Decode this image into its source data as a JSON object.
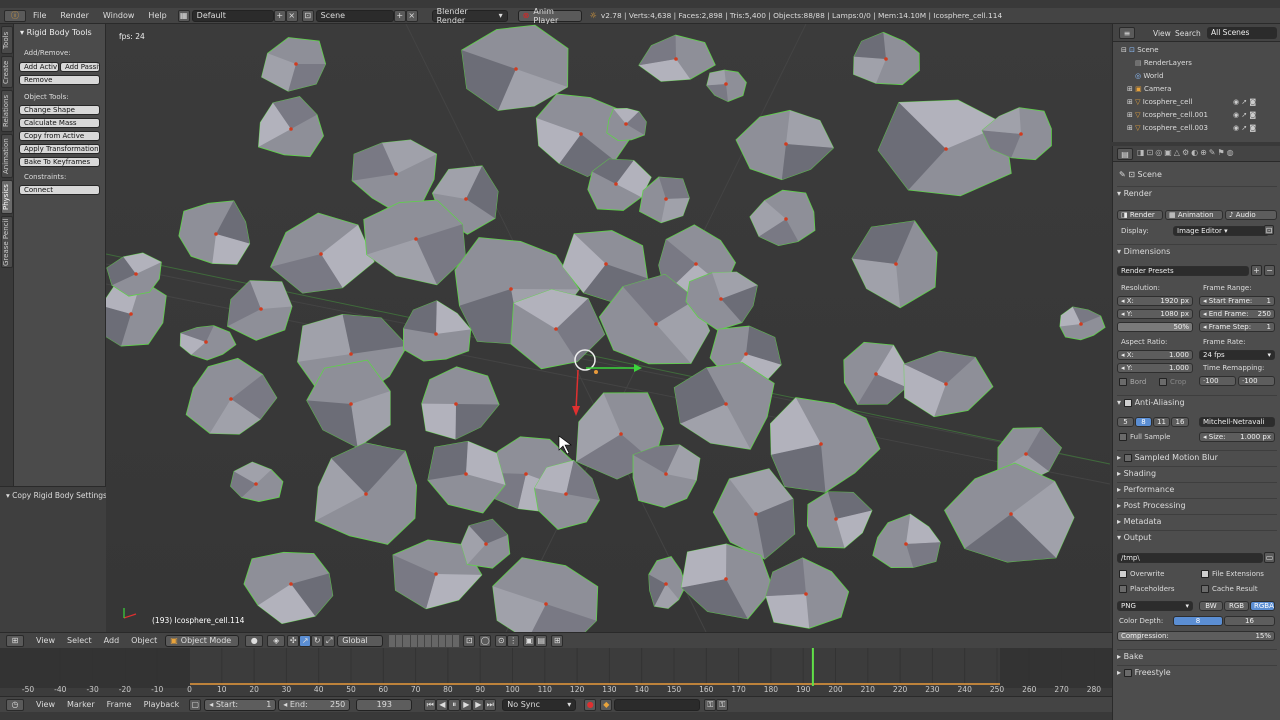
{
  "topbar": {
    "menus": [
      "File",
      "Render",
      "Window",
      "Help"
    ],
    "layout": "Default",
    "scene": "Scene",
    "engine": "Blender Render",
    "anim_player": "Anim Player",
    "stats": "v2.78 | Verts:4,638 | Faces:2,898 | Tris:5,400 | Objects:88/88 | Lamps:0/0 | Mem:14.10M | Icosphere_cell.114"
  },
  "left_tabs": [
    "Tools",
    "Create",
    "Relations",
    "Animation",
    "Physics",
    "Grease Pencil"
  ],
  "toolshelf": {
    "panel_title": "Rigid Body Tools",
    "add_remove_label": "Add/Remove:",
    "add_active": "Add Activ",
    "add_passive": "Add Passiv",
    "remove": "Remove",
    "object_tools_label": "Object Tools:",
    "object_tools": [
      "Change Shape",
      "Calculate Mass",
      "Copy from Active",
      "Apply Transformation",
      "Bake To Keyframes"
    ],
    "constraints_label": "Constraints:",
    "connect": "Connect"
  },
  "lower_panel": {
    "title": "Copy Rigid Body Settings"
  },
  "viewport": {
    "fps": "fps: 24",
    "object_label": "(193) Icosphere_cell.114",
    "rock_color": "#8e8f98",
    "outline_color": "#5fd14a",
    "origin_color": "#d23b1e"
  },
  "outliner": {
    "menus": [
      "View",
      "Search"
    ],
    "filter": "All Scenes",
    "items": [
      "Scene",
      "RenderLayers",
      "World",
      "Camera",
      "Icosphere_cell",
      "Icosphere_cell.001",
      "Icosphere_cell.003"
    ]
  },
  "props": {
    "context": "Scene",
    "render_section": "Render",
    "render_btn": "Render",
    "animation_btn": "Animation",
    "audio_btn": "Audio",
    "display_label": "Display:",
    "display_value": "Image Editor",
    "dimensions_section": "Dimensions",
    "render_presets": "Render Presets",
    "resolution_label": "Resolution:",
    "res_x": "X:",
    "res_x_val": "1920 px",
    "res_y": "Y:",
    "res_y_val": "1080 px",
    "res_pct": "50%",
    "frame_range_label": "Frame Range:",
    "start_frame": "Start Frame:",
    "start_frame_val": "1",
    "end_frame": "End Frame:",
    "end_frame_val": "250",
    "frame_step": "Frame Step:",
    "frame_step_val": "1",
    "aspect_label": "Aspect Ratio:",
    "asp_x": "X:",
    "asp_x_val": "1.000",
    "asp_y": "Y:",
    "asp_y_val": "1.000",
    "frame_rate_label": "Frame Rate:",
    "frame_rate_val": "24 fps",
    "time_remap_label": "Time Remapping:",
    "remap_old": "·100",
    "remap_new": "·100",
    "bord": "Bord",
    "crop": "Crop",
    "aa_section": "Anti-Aliasing",
    "aa_samples": [
      "5",
      "8",
      "11",
      "16"
    ],
    "aa_filter": "Mitchell-Netravali",
    "full_sample": "Full Sample",
    "size_label": "Size:",
    "size_val": "1.000 px",
    "sampled_motion_blur": "Sampled Motion Blur",
    "shading": "Shading",
    "performance": "Performance",
    "post_processing": "Post Processing",
    "metadata": "Metadata",
    "output_section": "Output",
    "output_path": "/tmp\\",
    "overwrite": "Overwrite",
    "file_extensions": "File Extensions",
    "placeholders": "Placeholders",
    "cache_result": "Cache Result",
    "format": "PNG",
    "bw": "BW",
    "rgb": "RGB",
    "rgba": "RGBA",
    "color_depth_label": "Color Depth:",
    "depth_8": "8",
    "depth_16": "16",
    "compression_label": "Compression:",
    "compression_val": "15%",
    "bake": "Bake",
    "freestyle": "Freestyle"
  },
  "view_header": {
    "menus": [
      "View",
      "Select",
      "Add",
      "Object"
    ],
    "mode": "Object Mode",
    "orientation": "Global"
  },
  "timeline": {
    "ticks": [
      "-50",
      "-40",
      "-30",
      "-20",
      "-10",
      "0",
      "10",
      "20",
      "30",
      "40",
      "50",
      "60",
      "70",
      "80",
      "90",
      "100",
      "110",
      "120",
      "130",
      "140",
      "150",
      "160",
      "170",
      "180",
      "190",
      "200",
      "210",
      "220",
      "230",
      "240",
      "250",
      "260",
      "270",
      "280"
    ],
    "current_frame": 193,
    "menus": [
      "View",
      "Marker",
      "Frame",
      "Playback"
    ],
    "start_label": "Start:",
    "start_val": "1",
    "end_label": "End:",
    "end_val": "250",
    "current_val": "193",
    "sync": "No Sync"
  }
}
